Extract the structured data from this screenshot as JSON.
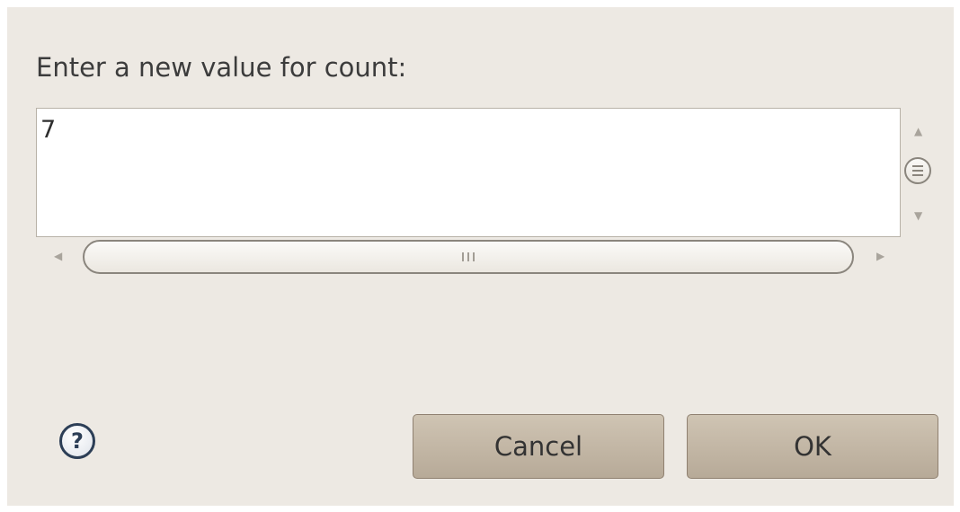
{
  "dialog": {
    "prompt": "Enter a new value for count:",
    "value": "7",
    "buttons": {
      "cancel": "Cancel",
      "ok": "OK"
    },
    "help_icon": "help-icon"
  },
  "colors": {
    "background": "#ede9e3",
    "button": "#c2b6a5",
    "help_icon": "#2c3e56"
  }
}
